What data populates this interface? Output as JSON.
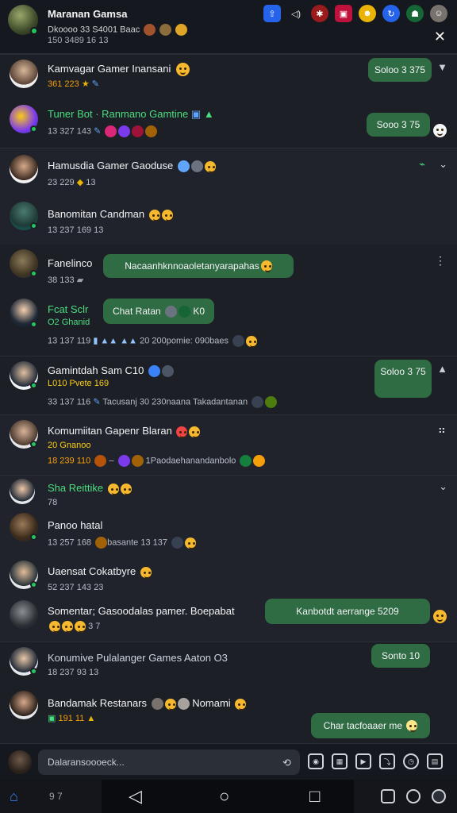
{
  "header": {
    "title": "Maranan Gamsa",
    "subtitle": "Dkoooo 33 S4001 Baac",
    "subtitle2": "150 3489 16 13",
    "icons": [
      "share-icon",
      "sound-icon",
      "app-red-icon",
      "gift-icon",
      "gamer-icon",
      "refresh-icon",
      "android-icon",
      "profile-icon"
    ],
    "close_label": "✕"
  },
  "rows": [
    {
      "name": "Kamvagar Gamer Inansani",
      "meta": "361 223",
      "bubble": "Soloo 3 375"
    },
    {
      "name": "Tuner Bot · Ranmano Gamtine",
      "meta": "13 327 143",
      "bubble": "Sooo 3 75"
    },
    {
      "name": "Hamusdia Gamer Gaoduse",
      "meta": "23 229",
      "extra": "13"
    },
    {
      "name": "Banomitan Candman",
      "meta": "13 237 169 13"
    },
    {
      "name": "Fanelinco",
      "meta": "38 133",
      "bubble": "Nacaanhknnoaoletanyarapahas"
    },
    {
      "name": "Fcat Sclr",
      "name2": "O2 Ghanid",
      "meta": "13 137 119",
      "meta_extra": "20 200pomie: 090baes",
      "bubble": "Chat Ratan"
    },
    {
      "name": "Gamintdah Sam C10",
      "name2": "L010 Pvete 169",
      "meta": "33 137 116",
      "meta_extra": "Tacusanj 30 230naana Takadantanan",
      "bubble": "Soloo 3 75"
    },
    {
      "name": "Komumiitan Gapenr Blaran",
      "name2": "20 Gnanoo",
      "meta": "18 239 110",
      "meta_extra": "1Paodaehanandanbolo"
    },
    {
      "name": "Sha Reittike",
      "meta": "78"
    },
    {
      "name": "Panoo hatal",
      "meta": "13 257 168",
      "meta_extra": "basante 13 137"
    },
    {
      "name": "Uaensat Cokatbyre",
      "meta": "52 237 143 23"
    },
    {
      "name": "Somentar; Gasoodalas pamer. Boepabat",
      "meta": "3 7",
      "bubble": "Kanbotdt aerrange 5209"
    },
    {
      "name": "Konumive Pulalanger Games Aaton O3",
      "meta": "18 237 93 13",
      "bubble": "Sonto 10"
    },
    {
      "name": "Bandamak Restanars",
      "name_extra": "Nomami",
      "meta": "191 11",
      "bubble": "Char tacfoaaer me"
    }
  ],
  "composer": {
    "placeholder": "Dalaransoooeck..."
  },
  "navbar": {
    "count": "9 7"
  },
  "colors": {
    "bubble": "#2f6b43",
    "accent_green": "#4ade80",
    "background": "#1c1f26"
  }
}
